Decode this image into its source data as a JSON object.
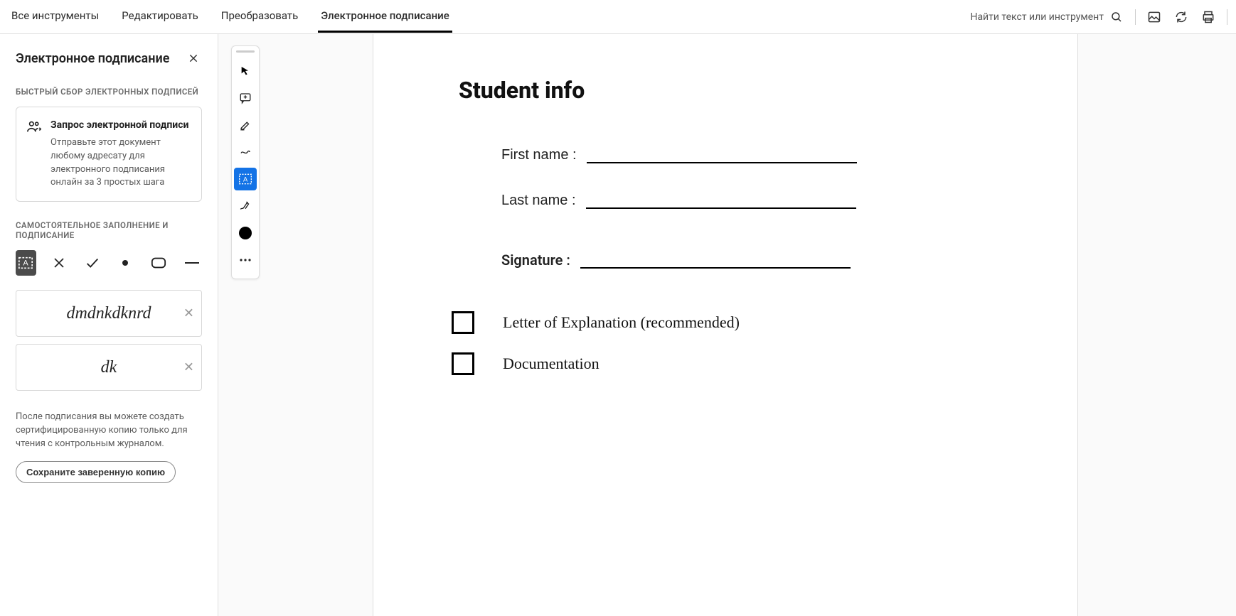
{
  "topbar": {
    "tabs": [
      {
        "label": "Все инструменты",
        "active": false
      },
      {
        "label": "Редактировать",
        "active": false
      },
      {
        "label": "Преобразовать",
        "active": false
      },
      {
        "label": "Электронное подписание",
        "active": true
      }
    ],
    "search_placeholder": "Найти текст или инструмент"
  },
  "sidebar": {
    "title": "Электронное подписание",
    "section1_label": "БЫСТРЫЙ СБОР ЭЛЕКТРОННЫХ ПОДПИСЕЙ",
    "card": {
      "title": "Запрос электронной подписи",
      "desc": "Отправьте этот документ любому адресату для электронного подписания онлайн за 3 простых шага"
    },
    "section2_label": "САМОСТОЯТЕЛЬНОЕ ЗАПОЛНЕНИЕ И ПОДПИСАНИЕ",
    "signatures": [
      {
        "text": "dmdnkdknrd"
      },
      {
        "text": "dk"
      }
    ],
    "note": "После подписания вы можете создать сертифицированную копию только для чтения с контрольным журналом.",
    "save_btn": "Сохраните заверенную копию"
  },
  "document": {
    "title": "Student info",
    "firstname_label": "First name :",
    "lastname_label": "Last name :",
    "signature_label": "Signature :",
    "checkbox1": "Letter of Explanation (recommended)",
    "checkbox2": "Documentation"
  }
}
